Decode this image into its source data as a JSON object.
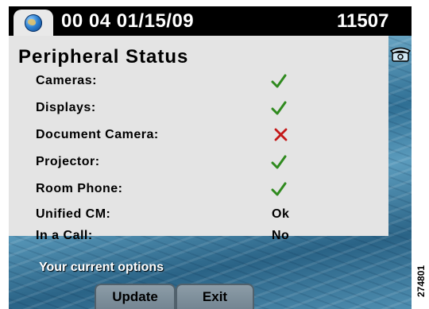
{
  "status_bar": {
    "datetime": "00 04 01/15/09",
    "extension": "11507"
  },
  "panel": {
    "title": "Peripheral Status",
    "rows": [
      {
        "label": "Cameras:",
        "status": "ok"
      },
      {
        "label": "Displays:",
        "status": "ok"
      },
      {
        "label": "Document Camera:",
        "status": "fail"
      },
      {
        "label": "Projector:",
        "status": "ok"
      },
      {
        "label": "Room Phone:",
        "status": "ok"
      },
      {
        "label": "Unified CM:",
        "value": "Ok"
      },
      {
        "label": "In a Call:",
        "value": "No"
      }
    ]
  },
  "footer": {
    "options_label": "Your current options",
    "softkeys": [
      "Update",
      "Exit"
    ]
  },
  "icons": {
    "status_ok": "checkmark-icon",
    "status_fail": "x-mark-icon",
    "line": "phone-icon",
    "globe": "globe-icon"
  },
  "colors": {
    "ok": "#2f8a1e",
    "fail": "#c41818"
  },
  "watermark": "274801"
}
